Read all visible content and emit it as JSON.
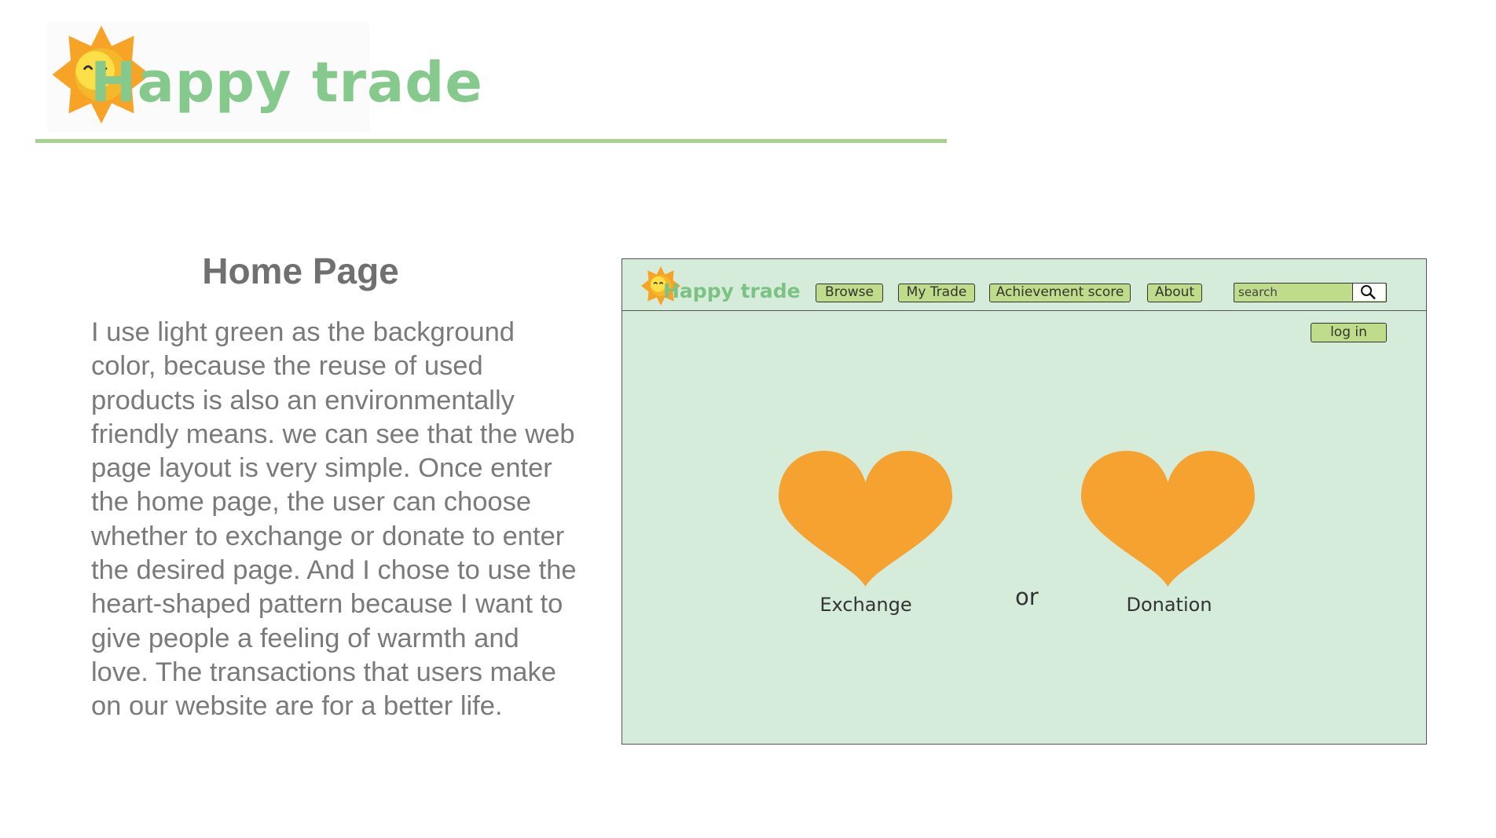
{
  "header": {
    "logo_text": "Happy trade"
  },
  "slide": {
    "title": "Home Page",
    "body": "I use light green as the background color, because the reuse of used products is also an environmentally friendly means. we can see that the web page layout is very simple. Once enter the home page, the user can choose whether to exchange or donate to enter the desired page. And I chose to use the heart-shaped pattern because I want to give people a feeling of warmth and love. The transactions that users make on our website are for a better life."
  },
  "mockup": {
    "logo_text": "Happy trade",
    "nav": [
      {
        "label": "Browse"
      },
      {
        "label": "My Trade"
      },
      {
        "label": "Achievement score"
      },
      {
        "label": "About"
      }
    ],
    "search": {
      "placeholder": "search"
    },
    "login_label": "log in",
    "options": {
      "left": "Exchange",
      "separator": "or",
      "right": "Donation"
    }
  },
  "colors": {
    "logo_green": "#86c98c",
    "rule_green": "#a9d18e",
    "mockup_background": "#d6ecdb",
    "button_green": "#bfdc8a",
    "heart_orange": "#f5a230",
    "sun_orange": "#f7a325",
    "sun_face_yellow": "#fde047",
    "body_text_gray": "#7a7a7a"
  }
}
